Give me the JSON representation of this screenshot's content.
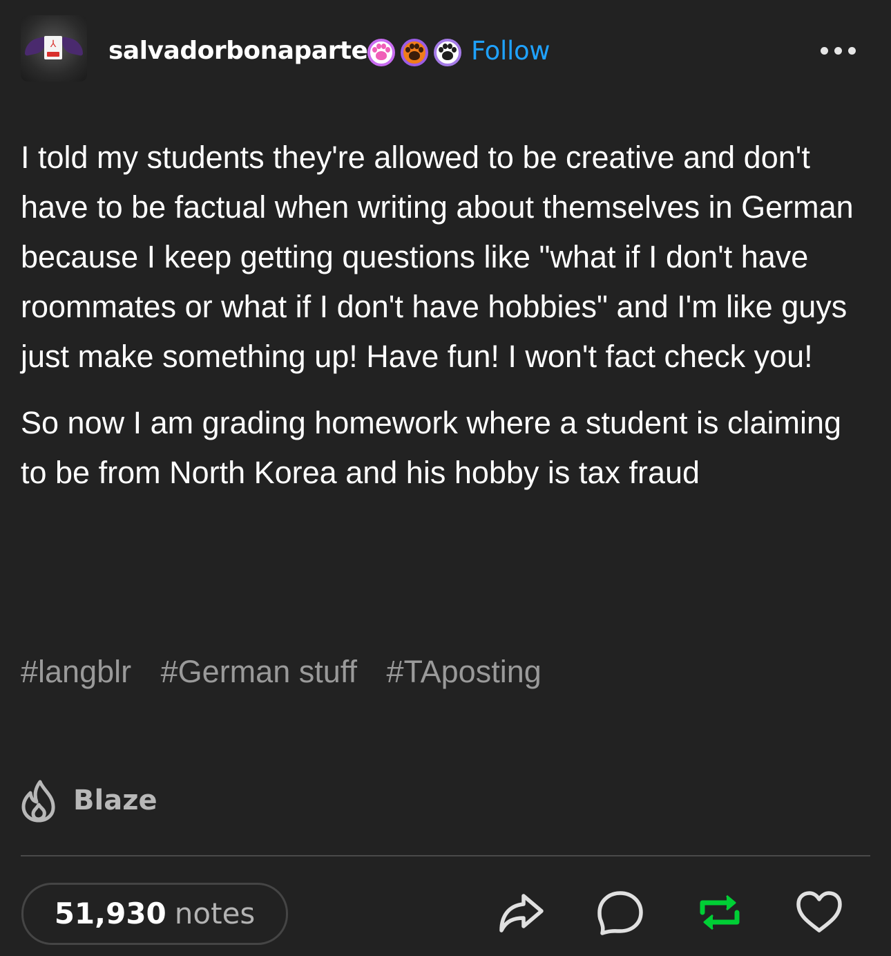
{
  "post": {
    "username": "salvadorbonaparte",
    "follow_label": "Follow",
    "badges": [
      "pink-paw-badge",
      "orange-paw-badge",
      "black-paw-badge"
    ],
    "paragraphs": [
      "I told my students they're allowed to be creative and don't have to be factual when writing about themselves in German because I keep getting questions like \"what if I don't have roommates or what if I don't have hobbies\" and I'm like guys just make something up! Have fun! I won't fact check you!",
      "So now I am grading homework where a student is claiming to be from North Korea and his hobby is tax fraud"
    ],
    "tags": [
      "#langblr",
      "#German stuff",
      "#TAposting"
    ]
  },
  "actions": {
    "blaze_label": "Blaze",
    "notes_count": "51,930",
    "notes_label": "notes",
    "icons": [
      "share-icon",
      "reply-icon",
      "reblog-icon",
      "like-icon"
    ]
  },
  "colors": {
    "background": "#222222",
    "follow": "#1fa2ff",
    "reblog": "#00cf35",
    "tag": "#9a9a9a"
  }
}
